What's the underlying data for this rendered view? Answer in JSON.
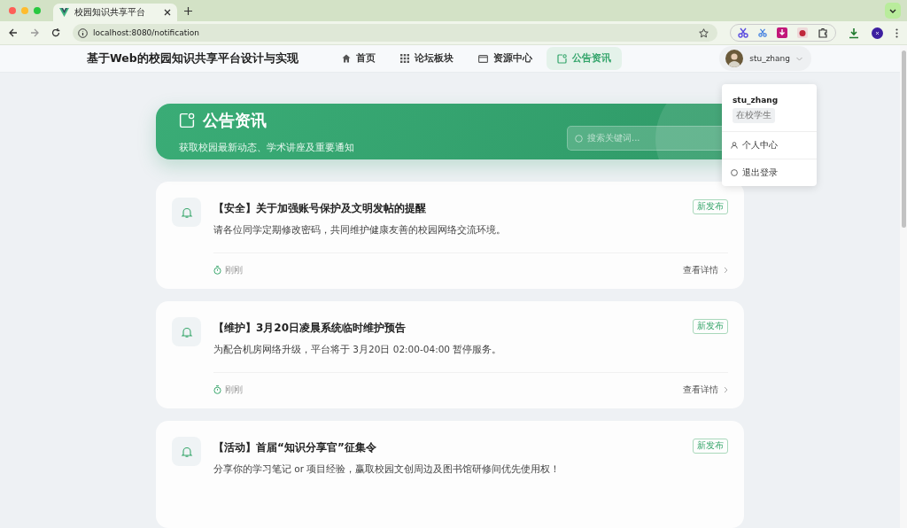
{
  "browser": {
    "tab_title": "校园知识共享平台",
    "url": "localhost:8080/notification"
  },
  "nav": {
    "brand": "基于Web的校园知识共享平台设计与实现",
    "items": [
      {
        "label": "首页",
        "selected": false
      },
      {
        "label": "论坛板块",
        "selected": false
      },
      {
        "label": "资源中心",
        "selected": false
      },
      {
        "label": "公告资讯",
        "selected": true
      }
    ],
    "user": {
      "name": "stu_zhang"
    }
  },
  "dropdown": {
    "name": "stu_zhang",
    "role": "在校学生",
    "items": [
      {
        "label": "个人中心"
      },
      {
        "label": "退出登录"
      }
    ]
  },
  "hero": {
    "title": "公告资讯",
    "subtitle": "获取校园最新动态、学术讲座及重要通知",
    "search": {
      "placeholder": "搜索关键词..."
    }
  },
  "notices": [
    {
      "title": "【安全】关于加强账号保护及文明发帖的提醒",
      "body": "请各位同学定期修改密码，共同维护健康友善的校园网络交流环境。",
      "tag": "新发布",
      "time": "刚刚",
      "action": "查看详情"
    },
    {
      "title": "【维护】3月20日凌晨系统临时维护预告",
      "body": "为配合机房网络升级，平台将于 3月20日 02:00-04:00 暂停服务。",
      "tag": "新发布",
      "time": "刚刚",
      "action": "查看详情"
    },
    {
      "title": "【活动】首届“知识分享官”征集令",
      "body": "分享你的学习笔记 or 项目经验，赢取校园文创周边及图书馆研修间优先使用权！",
      "tag": "新发布"
    }
  ]
}
